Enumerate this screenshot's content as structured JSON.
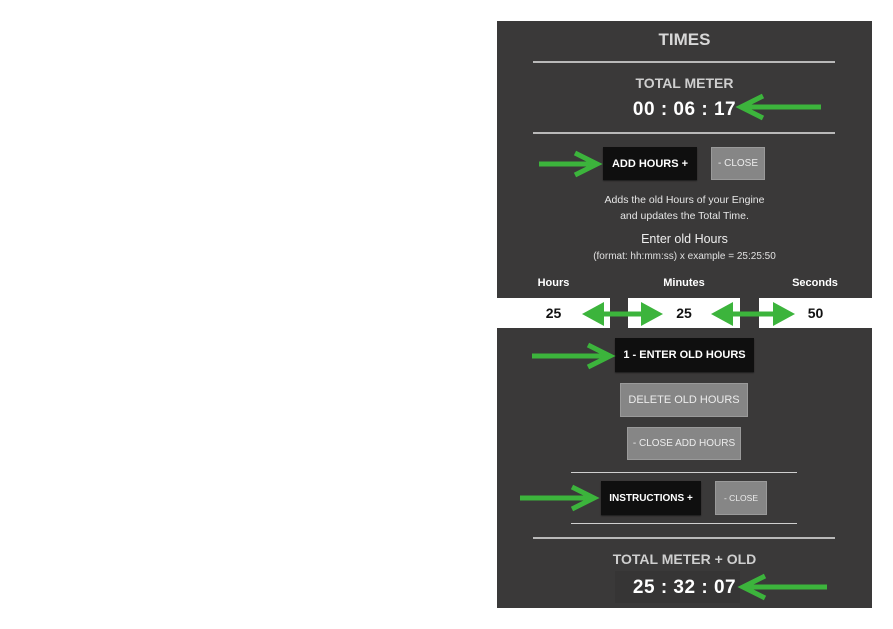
{
  "panel": {
    "title": "TIMES",
    "total_meter": {
      "label": "TOTAL METER",
      "value": "00 : 06 : 17"
    },
    "add_hours": {
      "open_button": "ADD HOURS +",
      "close_button": "- CLOSE",
      "description_line1": "Adds the old Hours of your Engine",
      "description_line2": "and updates the Total Time.",
      "enter_label": "Enter old Hours",
      "format_hint": "(format: hh:mm:ss) x example = 25:25:50",
      "fields": [
        {
          "label": "Hours",
          "value": "25"
        },
        {
          "label": "Minutes",
          "value": "25"
        },
        {
          "label": "Seconds",
          "value": "50"
        }
      ],
      "enter_button": "1 -  ENTER OLD HOURS",
      "delete_button": "DELETE OLD HOURS",
      "close_add_hours_button": "- CLOSE ADD HOURS"
    },
    "instructions": {
      "open_button": "INSTRUCTIONS +",
      "close_button": "- CLOSE"
    },
    "total_meter_old": {
      "label": "TOTAL METER + OLD",
      "value": "25 : 32 : 07"
    }
  },
  "colors": {
    "panel_bg": "#3a3939",
    "arrow_green": "#3cb43c",
    "button_dark": "#0f0f0f",
    "button_grey": "#868686"
  }
}
